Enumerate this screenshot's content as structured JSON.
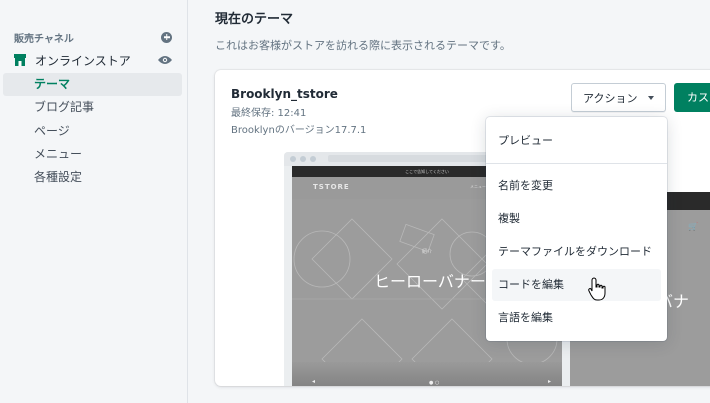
{
  "sidebar": {
    "section_title": "販売チャネル",
    "store_label": "オンラインストア",
    "items": [
      {
        "label": "テーマ",
        "active": true
      },
      {
        "label": "ブログ記事",
        "active": false
      },
      {
        "label": "ページ",
        "active": false
      },
      {
        "label": "メニュー",
        "active": false
      },
      {
        "label": "各種設定",
        "active": false
      }
    ]
  },
  "main": {
    "title": "現在のテーマ",
    "description": "これはお客様がストアを訪れる際に表示されるテーマです。"
  },
  "theme": {
    "name": "Brooklyn_tstore",
    "last_saved": "最終保存: 12:41",
    "version": "Brooklynのバージョン17.7.1",
    "action_label": "アクション",
    "customize_label": "カス"
  },
  "preview": {
    "announcement": "ここで告知してください",
    "logo": "TSTORE",
    "nav": "メニュー",
    "hero_small": "紹介",
    "hero_text": "ヒーローバナー",
    "mobile_hero_text": "バナ",
    "dots": "● ○",
    "arrow_left": "◂",
    "arrow_right": "▸",
    "cart": "🛒"
  },
  "dropdown": {
    "items": [
      {
        "label": "プレビュー"
      },
      {
        "label": "名前を変更"
      },
      {
        "label": "複製"
      },
      {
        "label": "テーマファイルをダウンロード"
      },
      {
        "label": "コードを編集",
        "hover": true
      },
      {
        "label": "言語を編集"
      }
    ]
  },
  "colors": {
    "accent": "#008060",
    "sidebar_bg": "#f4f6f8"
  }
}
